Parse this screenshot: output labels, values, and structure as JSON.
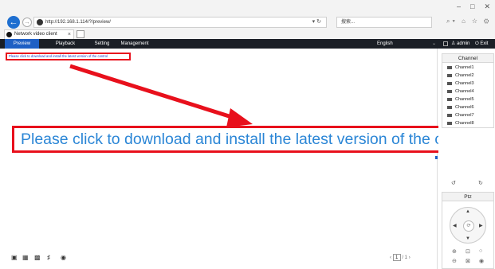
{
  "browser": {
    "url": "http://192.168.1.114/?/preview/",
    "search_placeholder": "搜索...",
    "tab_title": "Network video client",
    "win_min": "–",
    "win_max": "□",
    "win_close": "✕",
    "refresh": "▾ ↻",
    "icons": "⌕▾ ⌂ ☆ ⚙ ☺"
  },
  "nav": {
    "tabs": [
      "Preview",
      "Playback",
      "Setting",
      "Management"
    ],
    "language": "English",
    "user": "♙ admin",
    "exit": "⏻ Exit"
  },
  "main": {
    "small_link": "Please click to download and install the latest version of the control",
    "callout": "Please click to download and install the latest version of the control"
  },
  "bottom": {
    "page_current": "1",
    "page_total": "/ 1",
    "prev": "‹",
    "next": "›"
  },
  "channels": {
    "title": "Channel",
    "items": [
      "Channel1",
      "Channel2",
      "Channel3",
      "Channel4",
      "Channel5",
      "Channel6",
      "Channel7",
      "Channel8"
    ]
  },
  "ptz": {
    "title": "Ptz"
  },
  "colors": {
    "accent": "#1e5fc4",
    "annotation_red": "#e8101c",
    "callout_text": "#2b86d6",
    "nav_bg": "#1b1f26"
  }
}
